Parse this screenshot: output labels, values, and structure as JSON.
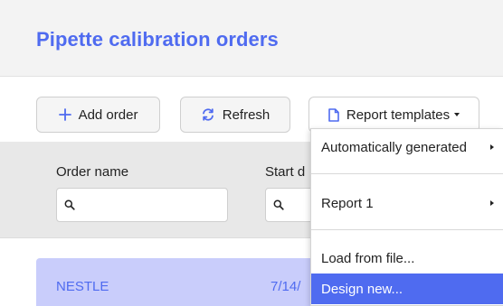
{
  "header": {
    "title": "Pipette calibration orders"
  },
  "toolbar": {
    "add_label": "Add order",
    "refresh_label": "Refresh",
    "templates_label": "Report templates"
  },
  "filters": {
    "columns": [
      {
        "label": "Order name"
      },
      {
        "label": "Start d"
      }
    ]
  },
  "rows": [
    {
      "name": "NESTLE",
      "start_date": "7/14/"
    }
  ],
  "menu": {
    "items": [
      {
        "label": "Automatically generated",
        "has_submenu": true
      },
      {
        "label": "Report 1",
        "has_submenu": true
      },
      {
        "label": "Load from file...",
        "has_submenu": false
      },
      {
        "label": "Design new...",
        "has_submenu": false,
        "highlighted": true
      }
    ]
  },
  "colors": {
    "accent": "#4f6bf0",
    "selected_row": "#c9cdfb",
    "filter_band": "#e8e8e8"
  },
  "icons": {
    "add": "plus-icon",
    "refresh": "refresh-icon",
    "templates": "document-icon",
    "search": "search-icon"
  }
}
